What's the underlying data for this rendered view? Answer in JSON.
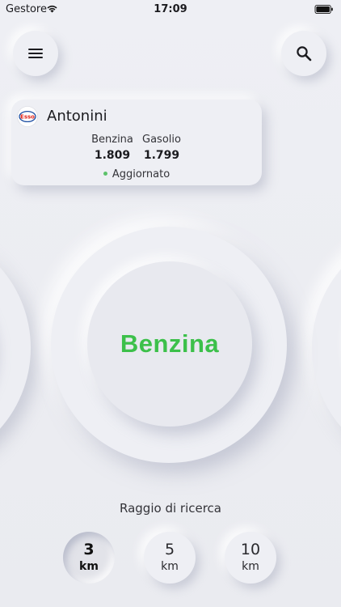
{
  "status_bar": {
    "carrier": "Gestore",
    "time": "17:09"
  },
  "header": {
    "menu_icon": "hamburger-menu-icon",
    "search_icon": "search-icon"
  },
  "station": {
    "brand_logo_text": "Esso",
    "name": "Antonini",
    "prices": [
      {
        "fuel": "Benzina",
        "price": "1.809"
      },
      {
        "fuel": "Gasolio",
        "price": "1.799"
      }
    ],
    "status": "Aggiornato",
    "status_color": "#5CC26A"
  },
  "fuel_selector": {
    "selected": "Benzina",
    "selected_color": "#3CC04A"
  },
  "radius": {
    "label": "Raggio di ricerca",
    "options": [
      {
        "value": "3",
        "unit": "km",
        "selected": true
      },
      {
        "value": "5",
        "unit": "km",
        "selected": false
      },
      {
        "value": "10",
        "unit": "km",
        "selected": false
      }
    ]
  }
}
